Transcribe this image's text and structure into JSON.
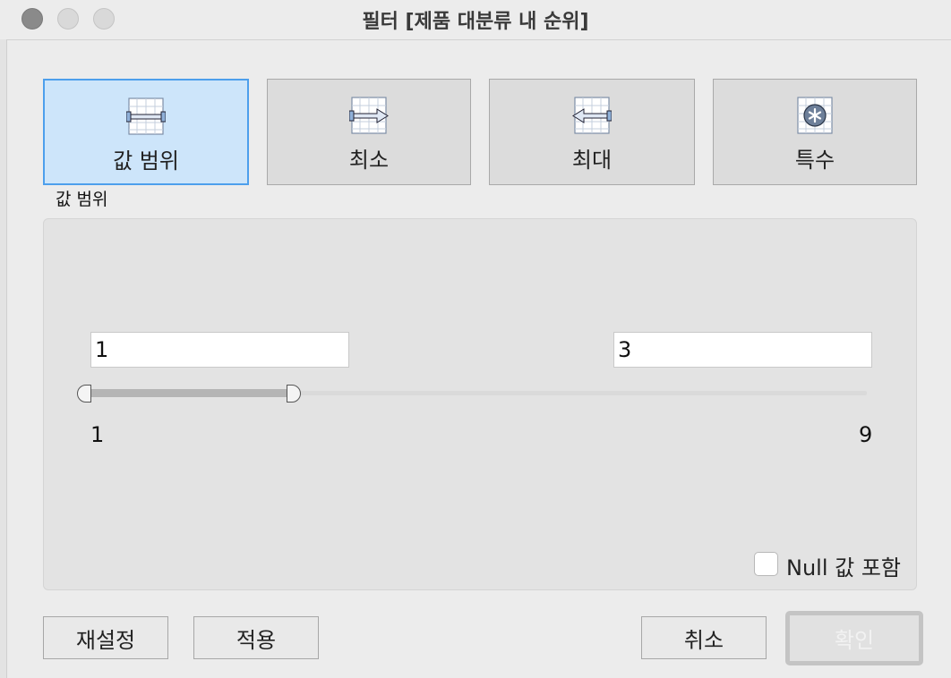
{
  "window": {
    "title": "필터 [제품 대분류 내 순위]"
  },
  "modes": [
    {
      "label": "값 범위",
      "icon": "range-icon",
      "selected": true
    },
    {
      "label": "최소",
      "icon": "at-least-icon",
      "selected": false
    },
    {
      "label": "최대",
      "icon": "at-most-icon",
      "selected": false
    },
    {
      "label": "특수",
      "icon": "special-icon",
      "selected": false
    }
  ],
  "section_label": "값 범위",
  "range": {
    "min_input": "1",
    "max_input": "3",
    "min_label": "1",
    "max_label": "9",
    "selected_start": 1,
    "selected_end": 3
  },
  "include_null": {
    "label": "Null 값 포함",
    "checked": false
  },
  "buttons": {
    "reset": "재설정",
    "apply": "적용",
    "cancel": "취소",
    "ok": "확인"
  }
}
